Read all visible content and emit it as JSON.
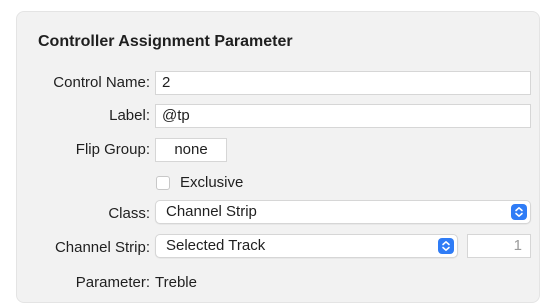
{
  "header": {
    "title": "Controller Assignment Parameter"
  },
  "form": {
    "control_name": {
      "label": "Control Name:",
      "value": "2"
    },
    "label_field": {
      "label": "Label:",
      "value": "@tp"
    },
    "flip_group": {
      "label": "Flip Group:",
      "value": "none"
    },
    "exclusive": {
      "label": "Exclusive",
      "checked": false
    },
    "class": {
      "label": "Class:",
      "value": "Channel Strip"
    },
    "channel_strip": {
      "label": "Channel Strip:",
      "value": "Selected Track",
      "number": "1"
    },
    "parameter": {
      "label": "Parameter:",
      "value": "Treble"
    }
  },
  "icons": {
    "popup": "chevron-up-down-icon"
  },
  "colors": {
    "accent": "#2f7cf6",
    "panel": "#f2f2f2"
  }
}
